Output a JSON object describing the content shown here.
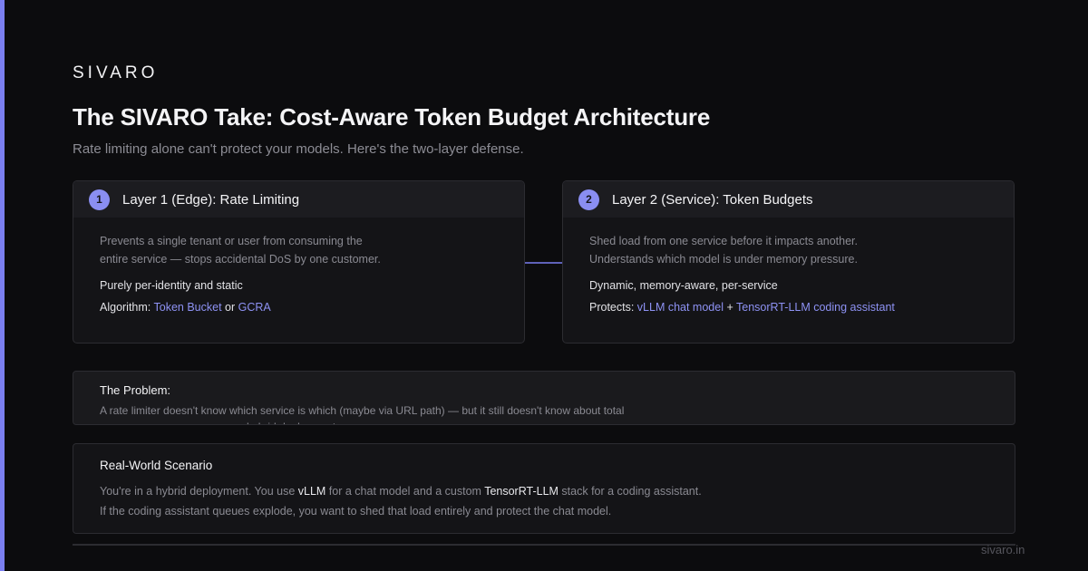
{
  "brand": "SIVARO",
  "title": "The SIVARO Take: Cost-Aware Token Budget Architecture",
  "subtitle": "Rate limiting alone can't protect your models. Here's the two-layer defense.",
  "layers": [
    {
      "number": "1",
      "title": "Layer 1 (Edge): Rate Limiting",
      "desc_line1": "Prevents a single tenant or user from consuming the",
      "desc_line2": "entire service — stops accidental DoS by one customer.",
      "property": "Purely per-identity and static",
      "detail_label": "Algorithm: ",
      "detail_link1": "Token Bucket",
      "detail_join": " or ",
      "detail_link2": "GCRA"
    },
    {
      "number": "2",
      "title": "Layer 2 (Service): Token Budgets",
      "desc_line1": "Shed load from one service before it impacts another.",
      "desc_line2": "Understands which model is under memory pressure.",
      "property": "Dynamic, memory-aware, per-service",
      "detail_label": "Protects: ",
      "detail_link1": "vLLM chat model",
      "detail_join": " + ",
      "detail_link2": "TensorRT-LLM coding assistant"
    }
  ],
  "problem": {
    "title": "The Problem:",
    "text": "A rate limiter doesn't know which service is which (maybe via URL path) — but it still doesn't know about total memory pressure across your hybrid deployment."
  },
  "scenario": {
    "title": "Real-World Scenario",
    "l1_a": "You're in a hybrid deployment. You use ",
    "l1_b": "vLLM",
    "l1_c": " for a chat model and a custom ",
    "l1_d": "TensorRT-LLM",
    "l1_e": " stack for a coding assistant.",
    "line2": "If the coding assistant queues explode, you want to shed that load entirely and protect the chat model."
  },
  "footer": "sivaro.in",
  "colors": {
    "accent": "#7b7ff0",
    "link": "#8e92f4",
    "background": "#0c0c0e"
  }
}
